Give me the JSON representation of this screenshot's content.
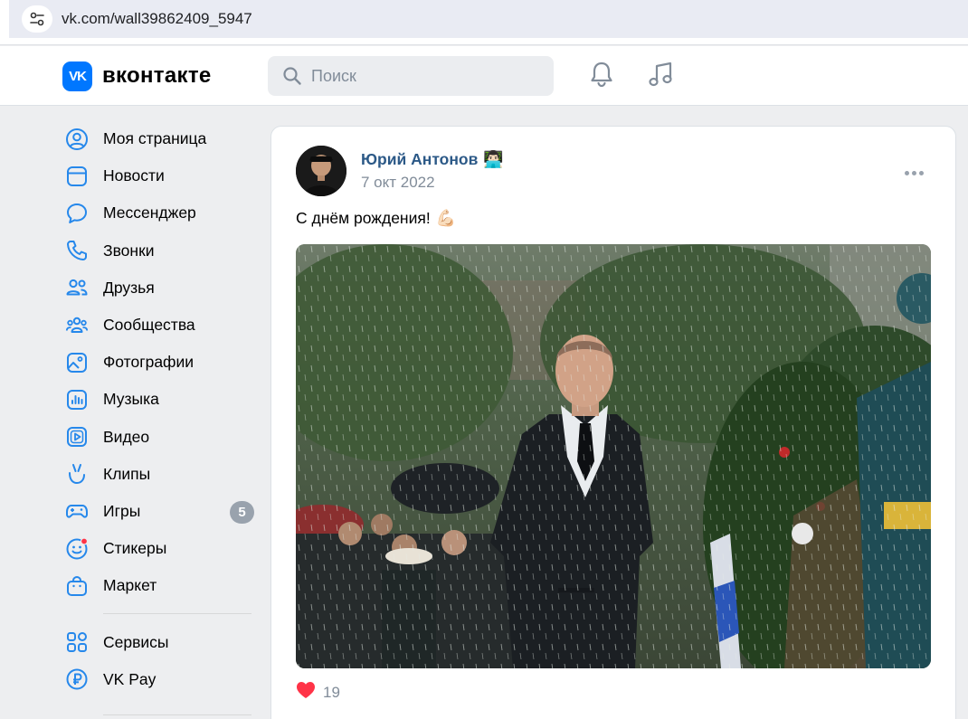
{
  "browser": {
    "url": "vk.com/wall39862409_5947"
  },
  "header": {
    "logo_mark": "VK",
    "logo_text": "вконтакте",
    "search_placeholder": "Поиск",
    "icons": [
      "notifications-bell-icon",
      "music-note-icon"
    ]
  },
  "sidebar": {
    "items": [
      {
        "label": "Моя страница",
        "icon": "user-circle-icon"
      },
      {
        "label": "Новости",
        "icon": "newsfeed-icon"
      },
      {
        "label": "Мессенджер",
        "icon": "message-bubble-icon"
      },
      {
        "label": "Звонки",
        "icon": "phone-icon"
      },
      {
        "label": "Друзья",
        "icon": "friends-icon"
      },
      {
        "label": "Сообщества",
        "icon": "communities-icon"
      },
      {
        "label": "Фотографии",
        "icon": "photo-icon"
      },
      {
        "label": "Музыка",
        "icon": "music-icon"
      },
      {
        "label": "Видео",
        "icon": "video-icon"
      },
      {
        "label": "Клипы",
        "icon": "clips-icon"
      },
      {
        "label": "Игры",
        "icon": "gamepad-icon",
        "badge": "5"
      },
      {
        "label": "Стикеры",
        "icon": "sticker-icon"
      },
      {
        "label": "Маркет",
        "icon": "market-bag-icon"
      }
    ],
    "extra_items": [
      {
        "label": "Сервисы",
        "icon": "services-grid-icon"
      },
      {
        "label": "VK Pay",
        "icon": "ruble-icon"
      }
    ]
  },
  "post": {
    "author": "Юрий Антонов",
    "author_emoji": "👨🏻‍💻",
    "date": "7 окт 2022",
    "text": "С днём рождения!",
    "text_emoji": "💪🏻",
    "likes_count": "19"
  },
  "colors": {
    "brand": "#0077ff",
    "link": "#2c5987",
    "muted": "#818c99",
    "like_red": "#ff3347"
  }
}
